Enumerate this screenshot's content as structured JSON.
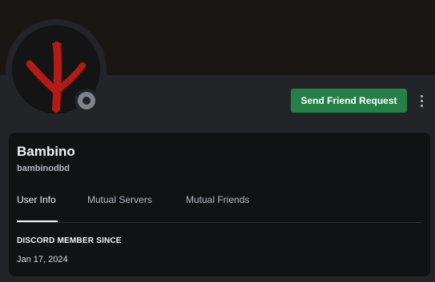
{
  "profile": {
    "display_name": "Bambino",
    "username": "bambinodbd",
    "avatar_icon": "red-glyph-avatar",
    "status": "offline",
    "status_color": "#80848e"
  },
  "actions": {
    "send_friend_request": "Send Friend Request",
    "more_icon": "more-vertical-icon"
  },
  "tabs": [
    {
      "label": "User Info",
      "active": true
    },
    {
      "label": "Mutual Servers",
      "active": false
    },
    {
      "label": "Mutual Friends",
      "active": false
    }
  ],
  "user_info": {
    "section_title": "DISCORD MEMBER SINCE",
    "member_since": "Jan 17, 2024"
  },
  "colors": {
    "banner": "#1a1614",
    "panel": "#232428",
    "card": "#111214",
    "accent_green": "#248046",
    "avatar_glyph": "#b31b17"
  }
}
